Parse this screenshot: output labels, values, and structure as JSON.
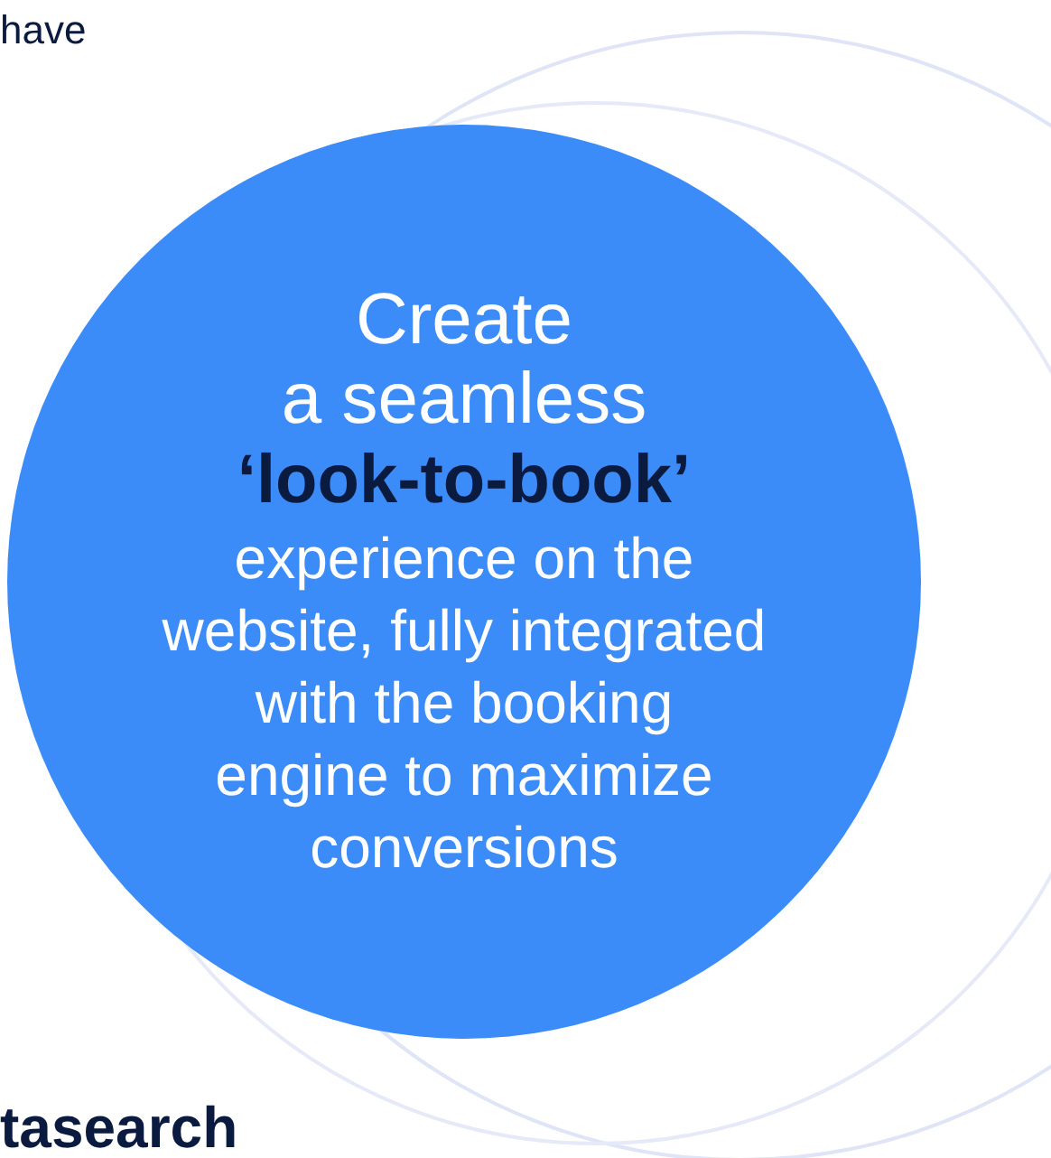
{
  "intro_fragment": "have",
  "circle": {
    "heading_lines": [
      "Create",
      "a seamless"
    ],
    "highlight": "‘look-to-book’",
    "body_lines": [
      "experience on the",
      "website, fully integrated",
      "with the booking",
      "engine to maximize",
      "conversions"
    ]
  },
  "next_heading_fragment": "tasearch"
}
